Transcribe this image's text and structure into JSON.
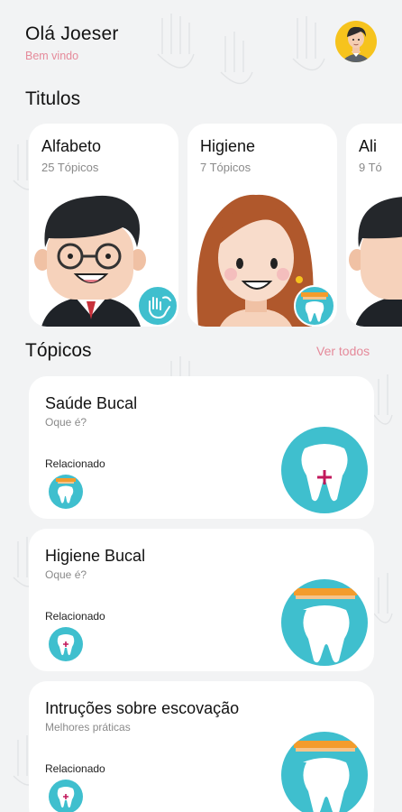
{
  "header": {
    "greeting": "Olá Joeser",
    "welcome": "Bem vindo"
  },
  "titles_section": {
    "title": "Titulos"
  },
  "title_cards": [
    {
      "title": "Alfabeto",
      "subtitle": "25 Tópicos",
      "icon": "sign-language-hand-icon"
    },
    {
      "title": "Higiene",
      "subtitle": "7 Tópicos",
      "icon": "tooth-brush-icon"
    },
    {
      "title": "Ali",
      "subtitle": "9 Tó",
      "icon": ""
    }
  ],
  "topics_section": {
    "title": "Tópicos",
    "see_all": "Ver todos"
  },
  "topics": [
    {
      "title": "Saúde Bucal",
      "subtitle": "Oque é?",
      "related_label": "Relacionado",
      "icon": "tooth-plus-icon"
    },
    {
      "title": "Higiene Bucal",
      "subtitle": "Oque é?",
      "related_label": "Relacionado",
      "icon": "tooth-brush-icon"
    },
    {
      "title": "Intruções sobre escovação",
      "subtitle": "Melhores práticas",
      "related_label": "Relacionado",
      "icon": "tooth-brush-icon"
    }
  ],
  "colors": {
    "accent": "#3fbfce",
    "pink": "#e58a9a",
    "avatar_bg": "#f6c31d",
    "background": "#f2f3f4"
  }
}
